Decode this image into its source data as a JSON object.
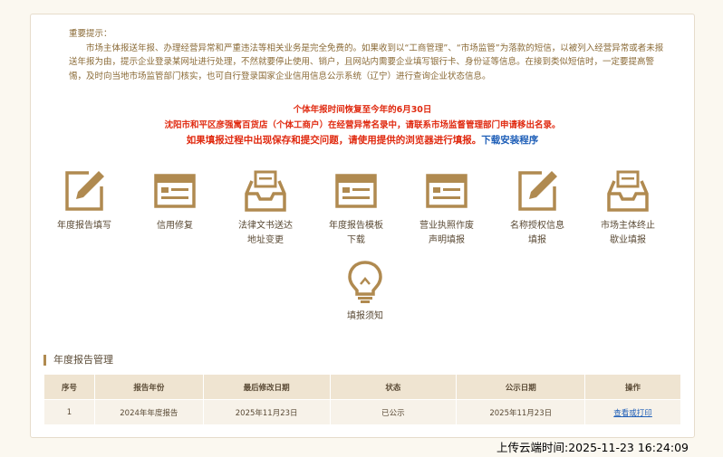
{
  "notice": {
    "heading": "重要提示：",
    "paragraph": "市场主体报送年报、办理经营异常和严重违法等相关业务是完全免费的。如果收到以“工商管理”、“市场监管”为落款的短信，以被列入经营异常或者未报送年报为由，提示企业登录某网址进行处理，不然就要停止使用、销户，且网站内需要企业填写银行卡、身份证等信息。在接到类似短信时，一定要提高警惕，及时向当地市场监管部门核实，也可自行登录国家企业信用信息公示系统（辽宁）进行查询企业状态信息。"
  },
  "alerts": {
    "line1": "个体年报时间恢复至今年的6月30日",
    "line2": "沈阳市和平区彦强寓百货店（个体工商户）在经营异常名录中，请联系市场监督管理部门申请移出名录。",
    "line3": "如果填报过程中出现保存和提交问题，请使用提供的浏览器进行填报。",
    "download_link": "下载安装程序"
  },
  "icons": [
    {
      "id": "annual-report-fill",
      "icon": "edit-icon",
      "line1": "年度报告填写",
      "line2": ""
    },
    {
      "id": "credit-repair",
      "icon": "card-icon",
      "line1": "信用修复",
      "line2": ""
    },
    {
      "id": "legal-doc-address",
      "icon": "inbox-icon",
      "line1": "法律文书送达",
      "line2": "地址变更"
    },
    {
      "id": "template-download",
      "icon": "card-icon",
      "line1": "年度报告模板",
      "line2": "下载"
    },
    {
      "id": "license-void",
      "icon": "card-icon",
      "line1": "营业执照作废",
      "line2": "声明填报"
    },
    {
      "id": "name-authorization",
      "icon": "edit-icon",
      "line1": "名称授权信息",
      "line2": "填报"
    },
    {
      "id": "business-termination",
      "icon": "inbox-icon",
      "line1": "市场主体终止",
      "line2": "歇业填报"
    },
    {
      "id": "fill-guide",
      "icon": "lightbulb-icon",
      "line1": "填报须知",
      "line2": ""
    }
  ],
  "section": {
    "title": "年度报告管理"
  },
  "table": {
    "headers": [
      "序号",
      "报告年份",
      "最后修改日期",
      "状态",
      "公示日期",
      "操作"
    ],
    "rows": [
      {
        "no": "1",
        "year": "2024年年度报告",
        "modified": "2025年11月23日",
        "status": "已公示",
        "published": "2025年11月23日",
        "action": "查看或打印"
      }
    ]
  },
  "upload_time": "上传云端时间:2025-11-23 16:24:09",
  "colors": {
    "accent": "#b08a50",
    "alert": "#e02a10",
    "link": "#1f5fb8"
  }
}
